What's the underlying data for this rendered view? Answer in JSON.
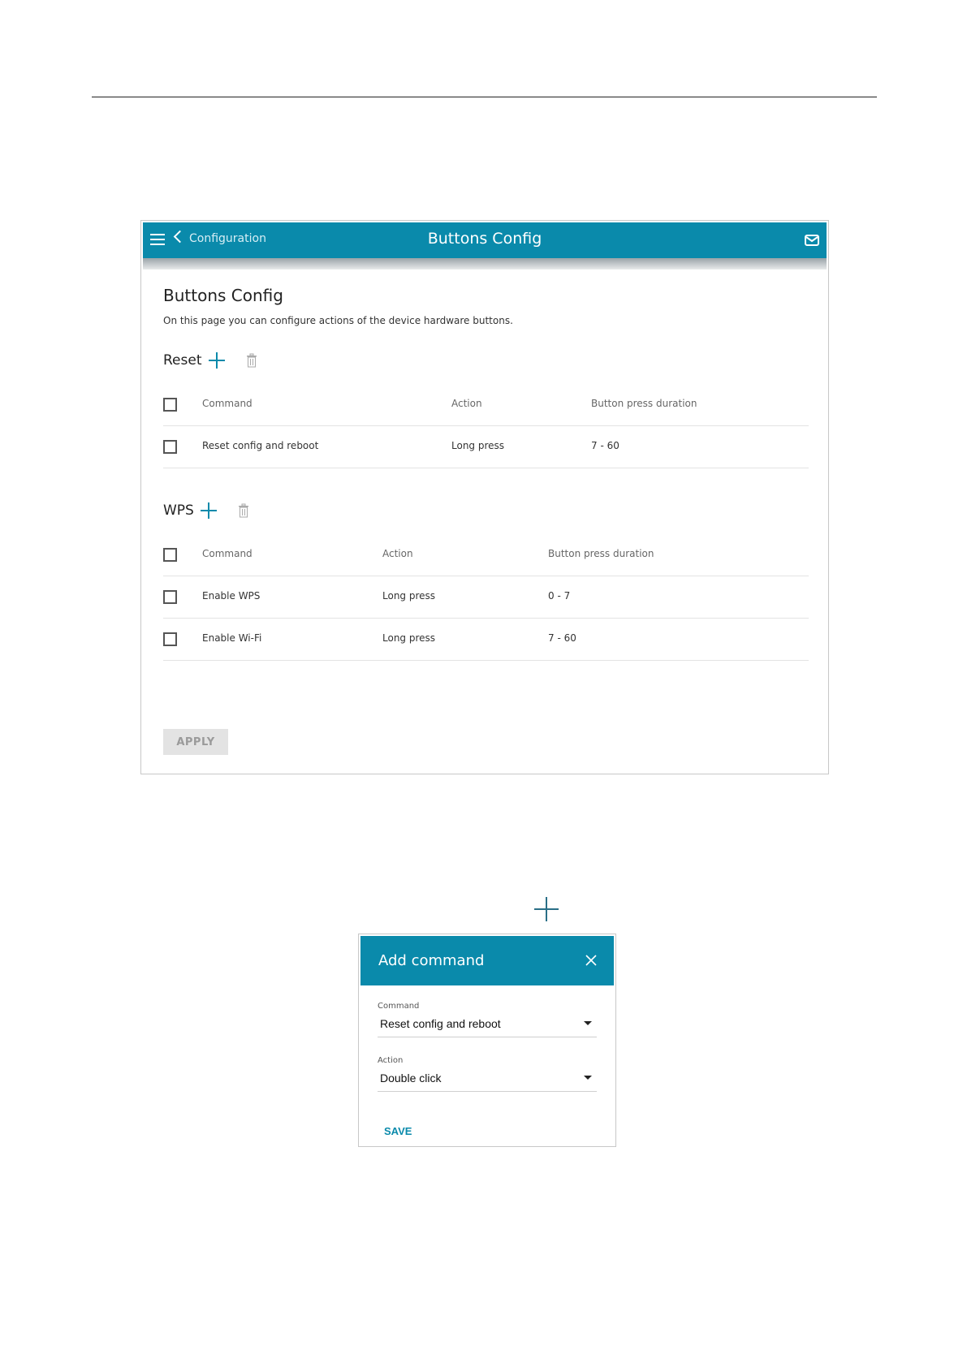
{
  "appbar": {
    "back_label": "Configuration",
    "title": "Buttons Config"
  },
  "page": {
    "title": "Buttons Config",
    "description": "On this page you can configure actions of the device hardware buttons."
  },
  "reset_section": {
    "title": "Reset",
    "headers": {
      "command": "Command",
      "action": "Action",
      "duration": "Button press duration"
    },
    "rows": [
      {
        "command": "Reset config and reboot",
        "action": "Long press",
        "duration": "7 - 60"
      }
    ]
  },
  "wps_section": {
    "title": "WPS",
    "headers": {
      "command": "Command",
      "action": "Action",
      "duration": "Button press duration"
    },
    "rows": [
      {
        "command": "Enable WPS",
        "action": "Long press",
        "duration": "0 - 7"
      },
      {
        "command": "Enable Wi-Fi",
        "action": "Long press",
        "duration": "7 - 60"
      }
    ]
  },
  "apply_label": "APPLY",
  "dialog": {
    "title": "Add command",
    "command_label": "Command",
    "command_value": "Reset config and reboot",
    "action_label": "Action",
    "action_value": "Double click",
    "save_label": "SAVE"
  },
  "colors": {
    "accent": "#0a8aab"
  },
  "icons": [
    "menu-icon",
    "chevron-left-icon",
    "mail-icon",
    "plus-icon",
    "trash-icon",
    "close-icon",
    "dropdown-caret-icon"
  ]
}
